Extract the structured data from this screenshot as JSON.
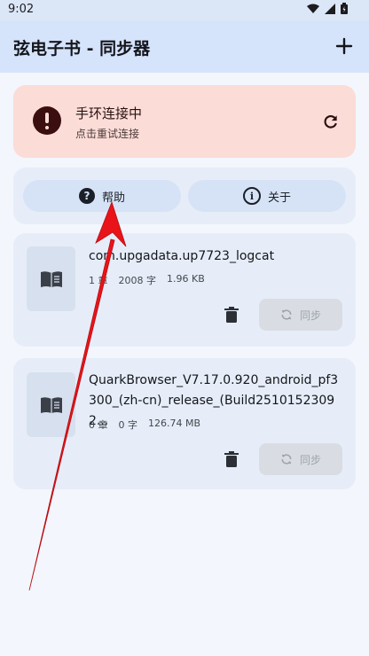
{
  "status_bar": {
    "time": "9:02"
  },
  "app_bar": {
    "title": "弦电子书 - 同步器",
    "add_icon": "plus-icon"
  },
  "connection": {
    "title": "手环连接中",
    "subtitle": "点击重试连接",
    "status_color": "#fbdcd7",
    "icon": "error-icon",
    "action_icon": "refresh-icon"
  },
  "tabs": [
    {
      "label": "帮助",
      "icon": "help-icon"
    },
    {
      "label": "关于",
      "icon": "info-icon"
    }
  ],
  "books": [
    {
      "name": "com.upgadata.up7723_logcat",
      "chapters": "1 章",
      "words": "2008 字",
      "size": "1.96 KB",
      "sync_label": "同步"
    },
    {
      "name": "QuarkBrowser_V7.17.0.920_android_pf3300_(zh-cn)_release_(Build25101523092...",
      "chapters": "0 章",
      "words": "0 字",
      "size": "126.74 MB",
      "sync_label": "同步"
    }
  ],
  "annotation": {
    "type": "red-arrow",
    "color": "#e8141a",
    "points_to": "help-button"
  }
}
